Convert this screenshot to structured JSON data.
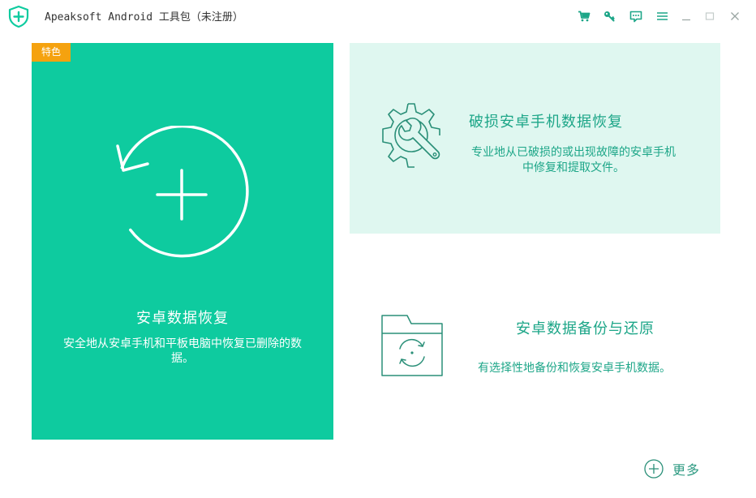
{
  "window": {
    "title": "Apeaksoft Android 工具包（未注册）",
    "controls": [
      {
        "name": "cart",
        "icon": "shopping-cart-icon"
      },
      {
        "name": "register",
        "icon": "key-icon"
      },
      {
        "name": "feedback",
        "icon": "chat-icon"
      },
      {
        "name": "menu",
        "icon": "menu-icon"
      },
      {
        "name": "minimize",
        "icon": "minimize-icon"
      },
      {
        "name": "maximize",
        "icon": "maximize-icon"
      },
      {
        "name": "close",
        "icon": "close-icon"
      }
    ]
  },
  "tiles": {
    "main": {
      "badge": "特色",
      "title": "安卓数据恢复",
      "description": "安全地从安卓手机和平板电脑中恢复已删除的数据。",
      "icon": "restore-add-icon"
    },
    "broken": {
      "title": "破损安卓手机数据恢复",
      "description": "专业地从已破损的或出现故障的安卓手机中修复和提取文件。",
      "icon": "gear-wrench-icon"
    },
    "backup": {
      "title": "安卓数据备份与还原",
      "description": "有选择性地备份和恢复安卓手机数据。",
      "icon": "folder-sync-icon"
    }
  },
  "more": {
    "label": "更多",
    "icon": "plus-circle-icon"
  },
  "colors": {
    "accent": "#0ecb9f",
    "accent_dark": "#1da688",
    "accent_light": "#dff7f0",
    "badge": "#f5a20f",
    "icon": "#2a8f78"
  }
}
